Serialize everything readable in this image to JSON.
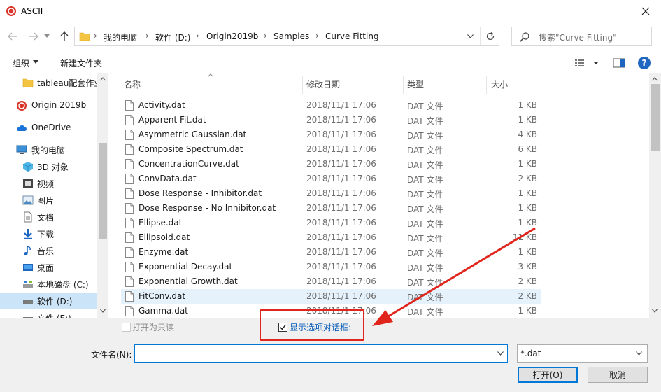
{
  "window": {
    "title": "ASCII"
  },
  "nav": {
    "breadcrumb": [
      "我的电脑",
      "软件 (D:)",
      "Origin2019b",
      "Samples",
      "Curve Fitting"
    ],
    "search_placeholder": "搜索\"Curve Fitting\""
  },
  "toolbar": {
    "organize_label": "组织",
    "new_folder_label": "新建文件夹"
  },
  "sidebar": {
    "items": [
      {
        "label": "tableau配套作业",
        "icon": "folder-icon"
      },
      {
        "label": "Origin 2019b",
        "icon": "origin-app-icon"
      },
      {
        "label": "OneDrive",
        "icon": "cloud-icon"
      },
      {
        "label": "我的电脑",
        "icon": "computer-icon"
      },
      {
        "label": "3D 对象",
        "icon": "cube-icon"
      },
      {
        "label": "视频",
        "icon": "video-icon"
      },
      {
        "label": "图片",
        "icon": "picture-icon"
      },
      {
        "label": "文档",
        "icon": "document-icon"
      },
      {
        "label": "下载",
        "icon": "download-icon"
      },
      {
        "label": "音乐",
        "icon": "music-icon"
      },
      {
        "label": "桌面",
        "icon": "desktop-icon"
      },
      {
        "label": "本地磁盘 (C:)",
        "icon": "drive-icon"
      },
      {
        "label": "软件 (D:)",
        "icon": "drive-icon",
        "selected": true
      },
      {
        "label": "文件 (E:)",
        "icon": "drive-icon"
      }
    ]
  },
  "file_list": {
    "columns": {
      "name": "名称",
      "date": "修改日期",
      "type": "类型",
      "size": "大小"
    },
    "rows": [
      {
        "name": "Activity.dat",
        "date": "2018/11/1 17:06",
        "type": "DAT 文件",
        "size": "1 KB"
      },
      {
        "name": "Apparent Fit.dat",
        "date": "2018/11/1 17:06",
        "type": "DAT 文件",
        "size": "1 KB"
      },
      {
        "name": "Asymmetric Gaussian.dat",
        "date": "2018/11/1 17:06",
        "type": "DAT 文件",
        "size": "4 KB"
      },
      {
        "name": "Composite Spectrum.dat",
        "date": "2018/11/1 17:06",
        "type": "DAT 文件",
        "size": "6 KB"
      },
      {
        "name": "ConcentrationCurve.dat",
        "date": "2018/11/1 17:06",
        "type": "DAT 文件",
        "size": "1 KB"
      },
      {
        "name": "ConvData.dat",
        "date": "2018/11/1 17:06",
        "type": "DAT 文件",
        "size": "2 KB"
      },
      {
        "name": "Dose Response - Inhibitor.dat",
        "date": "2018/11/1 17:06",
        "type": "DAT 文件",
        "size": "1 KB"
      },
      {
        "name": "Dose Response - No Inhibitor.dat",
        "date": "2018/11/1 17:06",
        "type": "DAT 文件",
        "size": "1 KB"
      },
      {
        "name": "Ellipse.dat",
        "date": "2018/11/1 17:06",
        "type": "DAT 文件",
        "size": "1 KB"
      },
      {
        "name": "Ellipsoid.dat",
        "date": "2018/11/1 17:06",
        "type": "DAT 文件",
        "size": "11 KB"
      },
      {
        "name": "Enzyme.dat",
        "date": "2018/11/1 17:06",
        "type": "DAT 文件",
        "size": "1 KB"
      },
      {
        "name": "Exponential Decay.dat",
        "date": "2018/11/1 17:06",
        "type": "DAT 文件",
        "size": "3 KB"
      },
      {
        "name": "Exponential Growth.dat",
        "date": "2018/11/1 17:06",
        "type": "DAT 文件",
        "size": "2 KB"
      },
      {
        "name": "FitConv.dat",
        "date": "2018/11/1 17:06",
        "type": "DAT 文件",
        "size": "2 KB",
        "selected": true
      },
      {
        "name": "Gamma.dat",
        "date": "2018/11/1 17:06",
        "type": "DAT 文件",
        "size": "1 KB"
      }
    ]
  },
  "options": {
    "open_readonly_label": "打开为只读",
    "open_readonly_checked": false,
    "show_options_label": "显示选项对话框:",
    "show_options_checked": true
  },
  "footer": {
    "filename_label": "文件名(N):",
    "filename_value": "",
    "filter_value": "*.dat",
    "open_label": "打开(O)",
    "cancel_label": "取消"
  },
  "colors": {
    "accent": "#0078d7",
    "annotation": "#e0261c",
    "selection": "#cce4f7"
  }
}
